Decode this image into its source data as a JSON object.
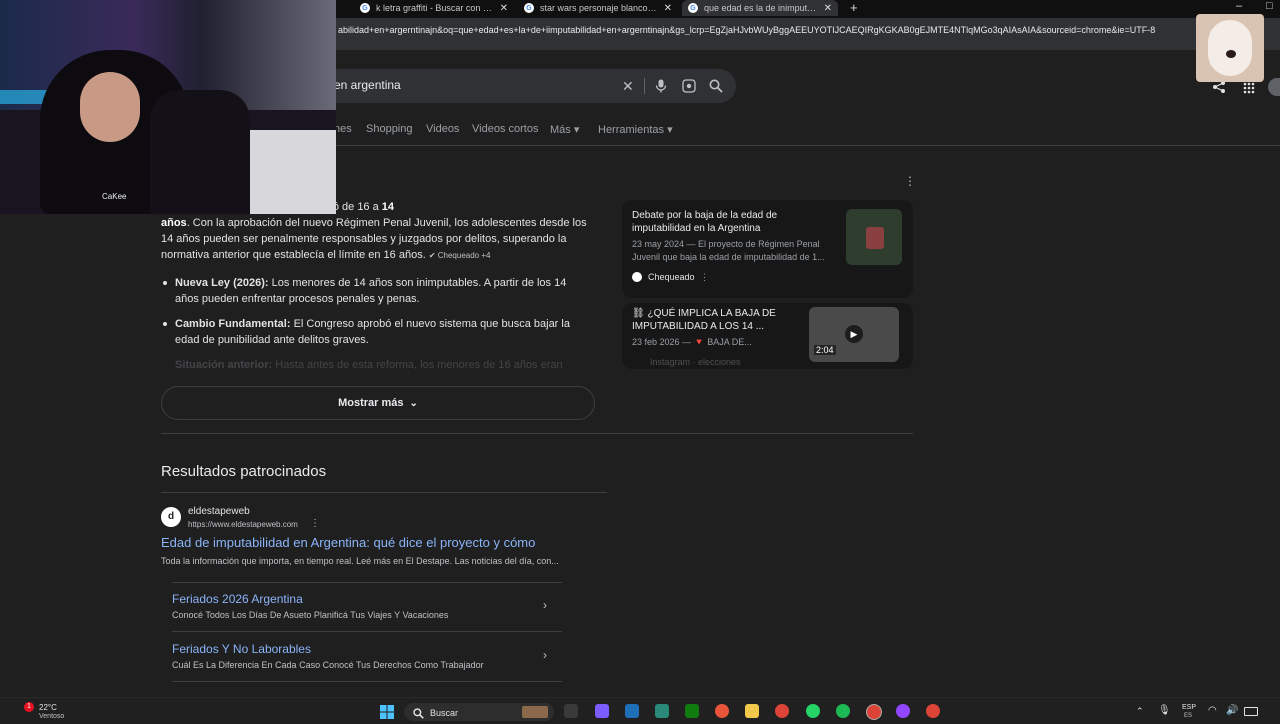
{
  "browser": {
    "tabs": [
      {
        "title": "k letra graffiti - Buscar con Goo",
        "active": false
      },
      {
        "title": "star wars personaje blanco - Bu",
        "active": false
      },
      {
        "title": "que edad es la de inimputabilid",
        "active": true
      }
    ],
    "new_tab": "+",
    "window_min": "–",
    "url": "abilidad+en+argerntinajn&oq=que+edad+es+la+de+iimputabilidad+en+argerntinajn&gs_lcrp=EgZjaHJvbWUyBggAEEUYOTIJCAEQIRgKGKAB0gEJMTE4NTlqMGo3qAIAsAIA&sourceid=chrome&ie=UTF-8"
  },
  "search": {
    "query_visible": "en argentina",
    "nav_tabs": [
      "nes",
      "Shopping",
      "Videos",
      "Videos cortos",
      "Más ▾",
      "Herramientas ▾"
    ]
  },
  "answer": {
    "line1_pre": "d de imputabilidad en Argentina bajó de 16 a ",
    "line1_bold": "14",
    "line2_bold": "años",
    "line2_rest": ". Con la aprobación del nuevo Régimen Penal Juvenil, los adolescentes desde los",
    "line3": "14 años pueden ser penalmente responsables y juzgados por delitos, superando la",
    "line4": "normativa anterior que establecía el límite en 16 años.",
    "checked": "✔ Chequeado +4",
    "bullets": [
      {
        "label": "Nueva Ley (2026):",
        "text1": " Los menores de 14 años son inimputables. A partir de los 14",
        "text2": "años pueden enfrentar procesos penales y penas."
      },
      {
        "label": "Cambio Fundamental:",
        "text1": " El Congreso aprobó el nuevo sistema que busca bajar la",
        "text2": "edad de punibilidad ante delitos graves."
      },
      {
        "label": "Situación anterior:",
        "text1": " Hasta antes de esta reforma, los menores de 16 años eran",
        "text2": ""
      }
    ],
    "show_more": "Mostrar más"
  },
  "sources": [
    {
      "title": "Debate por la baja de la edad de imputabilidad en la Argentina",
      "snippet": "23 may 2024 — El proyecto de Régimen Penal Juvenil que baja la edad de imputabilidad de 1...",
      "source": "Chequeado"
    },
    {
      "title": "⛓ ¿QUÉ IMPLICA LA BAJA DE IMPUTABILIDAD A LOS 14 ...",
      "snippet": "23 feb 2026 — 🔻 BAJA DE...",
      "source": "Instagram · elecciones",
      "duration": "2:04"
    }
  ],
  "sponsored": {
    "heading": "Resultados patrocinados",
    "site_name": "eldestapeweb",
    "site_url": "https://www.eldestapeweb.com",
    "title": "Edad de imputabilidad en Argentina: qué dice el proyecto y cómo",
    "desc": "Toda la información que importa, en tiempo real. Leé más en El Destape. Las noticias del día, con...",
    "sitelinks": [
      {
        "title": "Feriados 2026 Argentina",
        "desc": "Conocé Todos Los Días De Asueto Planificá Tus Viajes Y Vacaciones"
      },
      {
        "title": "Feriados Y No Laborables",
        "desc": "Cuál Es La Diferencia En Cada Caso Conocé Tus Derechos Como Trabajador"
      }
    ]
  },
  "taskbar": {
    "weather": "22°C",
    "weather_sub": "Ventoso",
    "search": "Buscar",
    "lang": "ESP",
    "lang_sub": "ES",
    "notif": "1"
  },
  "webcam": {
    "watermark": "CaKee"
  }
}
